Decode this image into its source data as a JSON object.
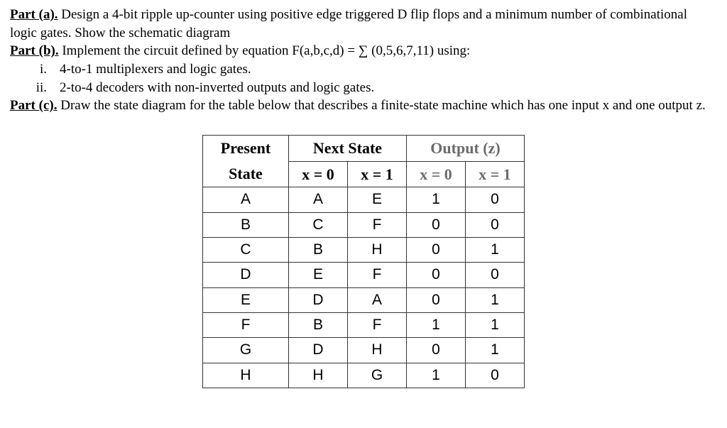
{
  "part_a": {
    "label": "Part (a).",
    "text": " Design a 4-bit ripple up-counter using positive edge triggered D flip flops and a minimum number of combinational logic gates. Show the schematic diagram"
  },
  "part_b": {
    "label": "Part (b).",
    "text": " Implement the circuit defined by equation F(a,b,c,d) = ∑ (0,5,6,7,11) using:",
    "items": [
      {
        "num": "i.",
        "text": "4-to-1 multiplexers and logic gates."
      },
      {
        "num": "ii.",
        "text": "2-to-4 decoders with non-inverted outputs and logic gates."
      }
    ]
  },
  "part_c": {
    "label": "Part (c).",
    "text": " Draw the state diagram for the table below that describes a finite-state machine which has one input x and one output z."
  },
  "table": {
    "headers": {
      "present_top": "Present",
      "present_bot": "State",
      "next": "Next State",
      "out": "Output (z)",
      "x0": "x = 0",
      "x1": "x = 1"
    },
    "rows": [
      {
        "ps": "A",
        "n0": "A",
        "n1": "E",
        "z0": "1",
        "z1": "0"
      },
      {
        "ps": "B",
        "n0": "C",
        "n1": "F",
        "z0": "0",
        "z1": "0"
      },
      {
        "ps": "C",
        "n0": "B",
        "n1": "H",
        "z0": "0",
        "z1": "1"
      },
      {
        "ps": "D",
        "n0": "E",
        "n1": "F",
        "z0": "0",
        "z1": "0"
      },
      {
        "ps": "E",
        "n0": "D",
        "n1": "A",
        "z0": "0",
        "z1": "1"
      },
      {
        "ps": "F",
        "n0": "B",
        "n1": "F",
        "z0": "1",
        "z1": "1"
      },
      {
        "ps": "G",
        "n0": "D",
        "n1": "H",
        "z0": "0",
        "z1": "1"
      },
      {
        "ps": "H",
        "n0": "H",
        "n1": "G",
        "z0": "1",
        "z1": "0"
      }
    ]
  }
}
